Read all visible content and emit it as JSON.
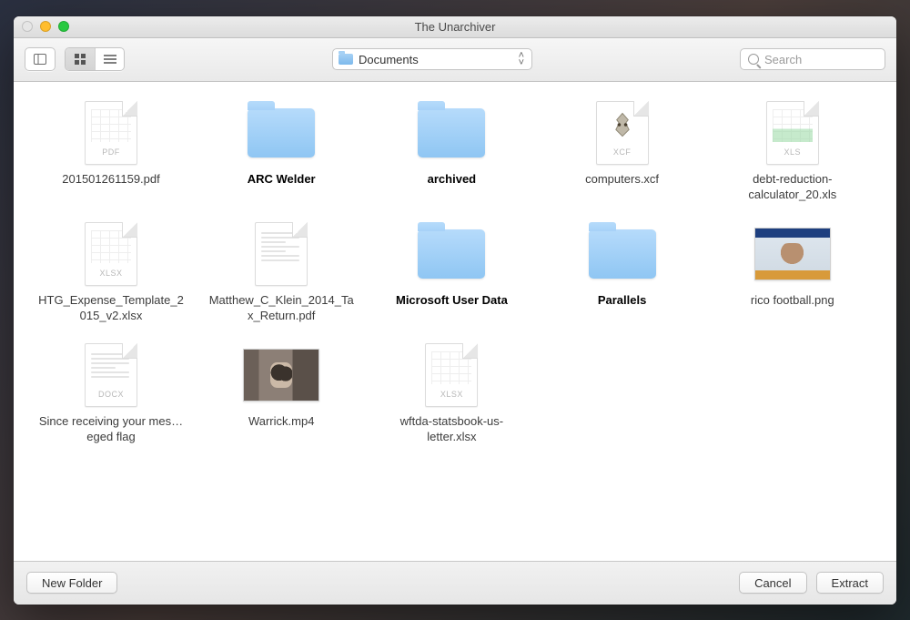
{
  "window": {
    "title": "The Unarchiver"
  },
  "toolbar": {
    "location_label": "Documents",
    "search_placeholder": "Search"
  },
  "files": [
    {
      "name": "201501261159.pdf",
      "kind": "pdf",
      "bold": false
    },
    {
      "name": "ARC Welder",
      "kind": "folder",
      "bold": true
    },
    {
      "name": "archived",
      "kind": "folder",
      "bold": true
    },
    {
      "name": "computers.xcf",
      "kind": "xcf",
      "bold": false
    },
    {
      "name": "debt-reduction-calculator_20.xls",
      "kind": "xls",
      "bold": false
    },
    {
      "name": "HTG_Expense_Template_2015_v2.xlsx",
      "kind": "xlsx",
      "bold": false
    },
    {
      "name": "Matthew_C_Klein_2014_Tax_Return.pdf",
      "kind": "pdf-doc",
      "bold": false
    },
    {
      "name": "Microsoft User Data",
      "kind": "folder",
      "bold": true
    },
    {
      "name": "Parallels",
      "kind": "folder",
      "bold": true
    },
    {
      "name": "rico football.png",
      "kind": "img-meme",
      "bold": false
    },
    {
      "name": "Since receiving your mes…eged flag",
      "kind": "docx",
      "bold": false
    },
    {
      "name": "Warrick.mp4",
      "kind": "video",
      "bold": false
    },
    {
      "name": "wftda-statsbook-us-letter.xlsx",
      "kind": "xlsx",
      "bold": false
    }
  ],
  "badges": {
    "pdf": "PDF",
    "xcf": "XCF",
    "xls": "XLS",
    "xlsx": "XLSX",
    "docx": "DOCX"
  },
  "footer": {
    "new_folder": "New Folder",
    "cancel": "Cancel",
    "confirm": "Extract"
  }
}
